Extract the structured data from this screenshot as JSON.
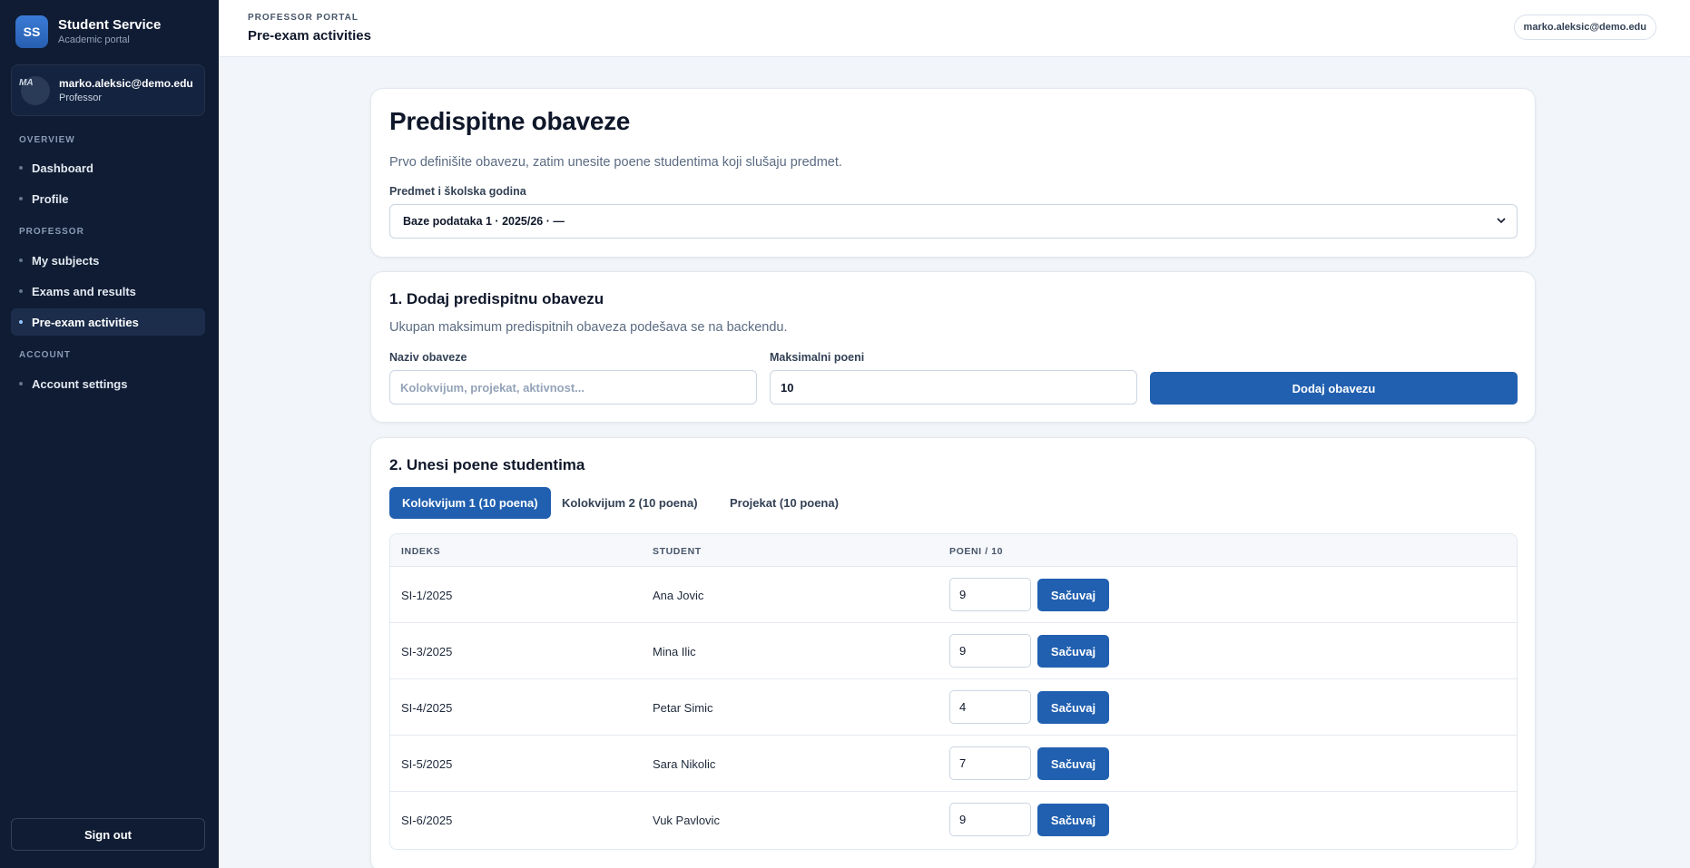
{
  "brand": {
    "logo": "SS",
    "title": "Student Service",
    "subtitle": "Academic portal"
  },
  "user": {
    "initials": "MA",
    "email": "marko.aleksic@demo.edu",
    "role": "Professor"
  },
  "nav": {
    "sections": {
      "overview": "OVERVIEW",
      "professor": "PROFESSOR",
      "account": "ACCOUNT"
    },
    "items": {
      "dashboard": "Dashboard",
      "profile": "Profile",
      "my_subjects": "My subjects",
      "exams": "Exams and results",
      "pre_exam": "Pre-exam activities",
      "account_settings": "Account settings"
    },
    "active": "pre_exam",
    "sign_out": "Sign out"
  },
  "topbar": {
    "kicker": "PROFESSOR PORTAL",
    "title": "Pre-exam activities",
    "user_chip": "marko.aleksic@demo.edu"
  },
  "header_card": {
    "title": "Predispitne obaveze",
    "description": "Prvo definišite obavezu, zatim unesite poene studentima koji slušaju predmet.",
    "select_label": "Predmet i školska godina",
    "select_value": "Baze podataka 1 · 2025/26 · —"
  },
  "add_card": {
    "title": "1. Dodaj predispitnu obavezu",
    "description": "Ukupan maksimum predispitnih obaveza podešava se na backendu.",
    "name_label": "Naziv obaveze",
    "name_placeholder": "Kolokvijum, projekat, aktivnost...",
    "name_value": "",
    "max_label": "Maksimalni poeni",
    "max_value": "10",
    "add_button": "Dodaj obavezu"
  },
  "points_card": {
    "title": "2. Unesi poene studentima",
    "tabs": [
      "Kolokvijum 1 (10 poena)",
      "Kolokvijum 2 (10 poena)",
      "Projekat (10 poena)"
    ],
    "active_tab": 0,
    "columns": {
      "index": "INDEKS",
      "student": "STUDENT",
      "points": "POENI / 10"
    },
    "save_label": "Sačuvaj",
    "rows": [
      {
        "index": "SI-1/2025",
        "student": "Ana Jovic",
        "points": "9"
      },
      {
        "index": "SI-3/2025",
        "student": "Mina Ilic",
        "points": "9"
      },
      {
        "index": "SI-4/2025",
        "student": "Petar Simic",
        "points": "4"
      },
      {
        "index": "SI-5/2025",
        "student": "Sara Nikolic",
        "points": "7"
      },
      {
        "index": "SI-6/2025",
        "student": "Vuk Pavlovic",
        "points": "9"
      }
    ]
  },
  "colors": {
    "sidebar": "#0f1c33",
    "primary": "#2160b0",
    "background": "#f2f5f9"
  },
  "icons": {
    "select_chevron": "chevron-down-icon",
    "nav_bullet": "dot-icon"
  }
}
